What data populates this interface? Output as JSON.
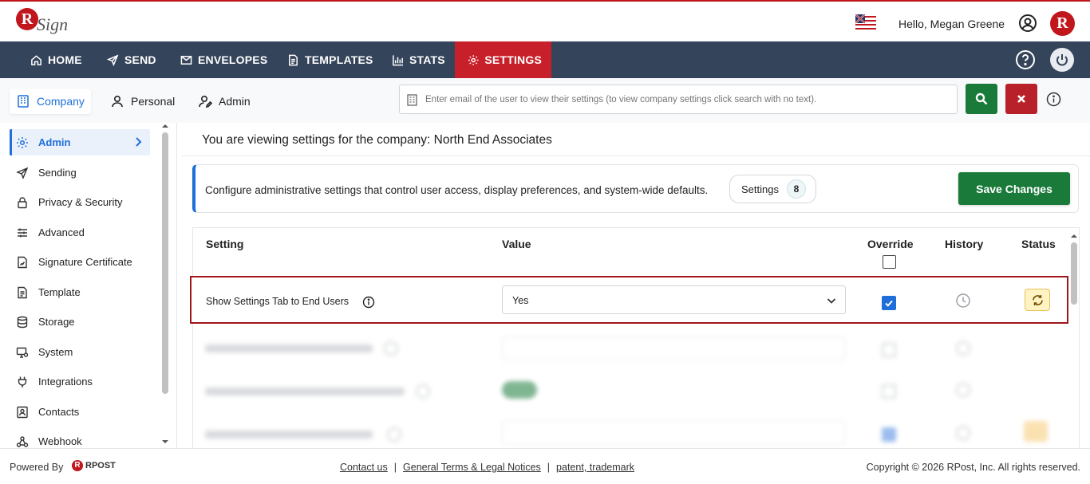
{
  "header": {
    "logo_text": "RSign",
    "greeting": "Hello, Megan Greene",
    "avatar_letter": "R"
  },
  "nav": {
    "items": [
      {
        "label": "HOME",
        "icon": "home-icon"
      },
      {
        "label": "SEND",
        "icon": "send-icon"
      },
      {
        "label": "ENVELOPES",
        "icon": "envelope-icon"
      },
      {
        "label": "TEMPLATES",
        "icon": "document-icon"
      },
      {
        "label": "STATS",
        "icon": "bar-chart-icon"
      },
      {
        "label": "SETTINGS",
        "icon": "gear-icon",
        "active": true
      }
    ]
  },
  "subtabs": {
    "company": "Company",
    "personal": "Personal",
    "admin": "Admin"
  },
  "search": {
    "placeholder": "Enter email of the user to view their settings (to view company settings click search with no text)."
  },
  "sidebar": {
    "items": [
      {
        "label": "Admin",
        "icon": "gear-icon",
        "active": true
      },
      {
        "label": "Sending",
        "icon": "send-icon"
      },
      {
        "label": "Privacy & Security",
        "icon": "lock-icon"
      },
      {
        "label": "Advanced",
        "icon": "sliders-icon"
      },
      {
        "label": "Signature Certificate",
        "icon": "certificate-icon"
      },
      {
        "label": "Template",
        "icon": "document-icon"
      },
      {
        "label": "Storage",
        "icon": "database-icon"
      },
      {
        "label": "System",
        "icon": "monitor-icon"
      },
      {
        "label": "Integrations",
        "icon": "plug-icon"
      },
      {
        "label": "Contacts",
        "icon": "contacts-icon"
      },
      {
        "label": "Webhook",
        "icon": "webhook-icon"
      }
    ]
  },
  "main": {
    "viewing_text": "You are viewing settings for the company: North End Associates",
    "description": "Configure administrative settings that control user access, display preferences, and system-wide defaults.",
    "settings_badge_label": "Settings",
    "settings_count": "8",
    "save_label": "Save Changes"
  },
  "table": {
    "headers": {
      "setting": "Setting",
      "value": "Value",
      "override": "Override",
      "history": "History",
      "status": "Status"
    },
    "highlighted_row": {
      "label": "Show Settings Tab to End Users",
      "value": "Yes",
      "override_checked": true
    }
  },
  "footer": {
    "powered_by": "Powered By",
    "rpost": "RPOST",
    "links": [
      "Contact us",
      "General Terms & Legal Notices",
      "patent, trademark"
    ],
    "copyright": "Copyright © 2026 RPost, Inc. All rights reserved."
  },
  "colors": {
    "brand_red": "#c0161c",
    "nav_bg": "#34445a",
    "accent_blue": "#1e6fd9",
    "save_green": "#1a7a3a"
  }
}
